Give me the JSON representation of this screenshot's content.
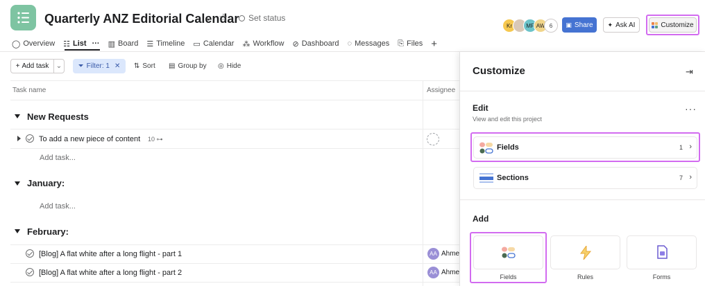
{
  "header": {
    "project_title": "Quarterly ANZ Editorial Calendar",
    "set_status": "Set status",
    "avatars": [
      {
        "initials": "Kr",
        "color": "#f6c84f"
      },
      {
        "initials": "",
        "color": "#d9c8b7"
      },
      {
        "initials": "MF",
        "color": "#6cc3c9"
      },
      {
        "initials": "AW",
        "color": "#f1d58a"
      }
    ],
    "member_count": "6",
    "share_label": "Share",
    "ask_ai_label": "Ask AI",
    "customize_label": "Customize"
  },
  "tabs": [
    {
      "label": "Overview",
      "icon": "overview-icon"
    },
    {
      "label": "List",
      "icon": "list-icon"
    },
    {
      "label": "Board",
      "icon": "board-icon"
    },
    {
      "label": "Timeline",
      "icon": "timeline-icon"
    },
    {
      "label": "Calendar",
      "icon": "calendar-icon"
    },
    {
      "label": "Workflow",
      "icon": "workflow-icon"
    },
    {
      "label": "Dashboard",
      "icon": "dashboard-icon"
    },
    {
      "label": "Messages",
      "icon": "messages-icon"
    },
    {
      "label": "Files",
      "icon": "files-icon"
    }
  ],
  "toolbar": {
    "add_task": "Add task",
    "filter": "Filter: 1",
    "sort": "Sort",
    "group_by": "Group by",
    "hide": "Hide"
  },
  "table": {
    "col_task": "Task name",
    "col_assignee": "Assignee",
    "add_task_inline": "Add task...",
    "sections": [
      {
        "title": "New Requests"
      },
      {
        "title": "January:"
      },
      {
        "title": "February:"
      }
    ],
    "tasks": [
      {
        "name": "To add a new piece of content",
        "subtasks": "10"
      },
      {
        "name": "[Blog] A flat white after a long flight - part 1",
        "assignee_initials": "AA",
        "assignee_name": "Ahmet"
      },
      {
        "name": "[Blog] A flat white after a long flight - part 2",
        "assignee_initials": "AA",
        "assignee_name": "Ahmet"
      }
    ]
  },
  "panel": {
    "title": "Customize",
    "edit_title": "Edit",
    "edit_subtitle": "View and edit this project",
    "fields_label": "Fields",
    "fields_count": "1",
    "sections_label": "Sections",
    "sections_count": "7",
    "add_title": "Add",
    "add_items": [
      {
        "label": "Fields",
        "icon": "fields-icon"
      },
      {
        "label": "Rules",
        "icon": "lightning-icon"
      },
      {
        "label": "Forms",
        "icon": "form-icon"
      }
    ]
  },
  "colors": {
    "accent_highlight": "#d26bf0",
    "share_blue": "#4573d2",
    "project_icon": "#7ec4a2"
  }
}
